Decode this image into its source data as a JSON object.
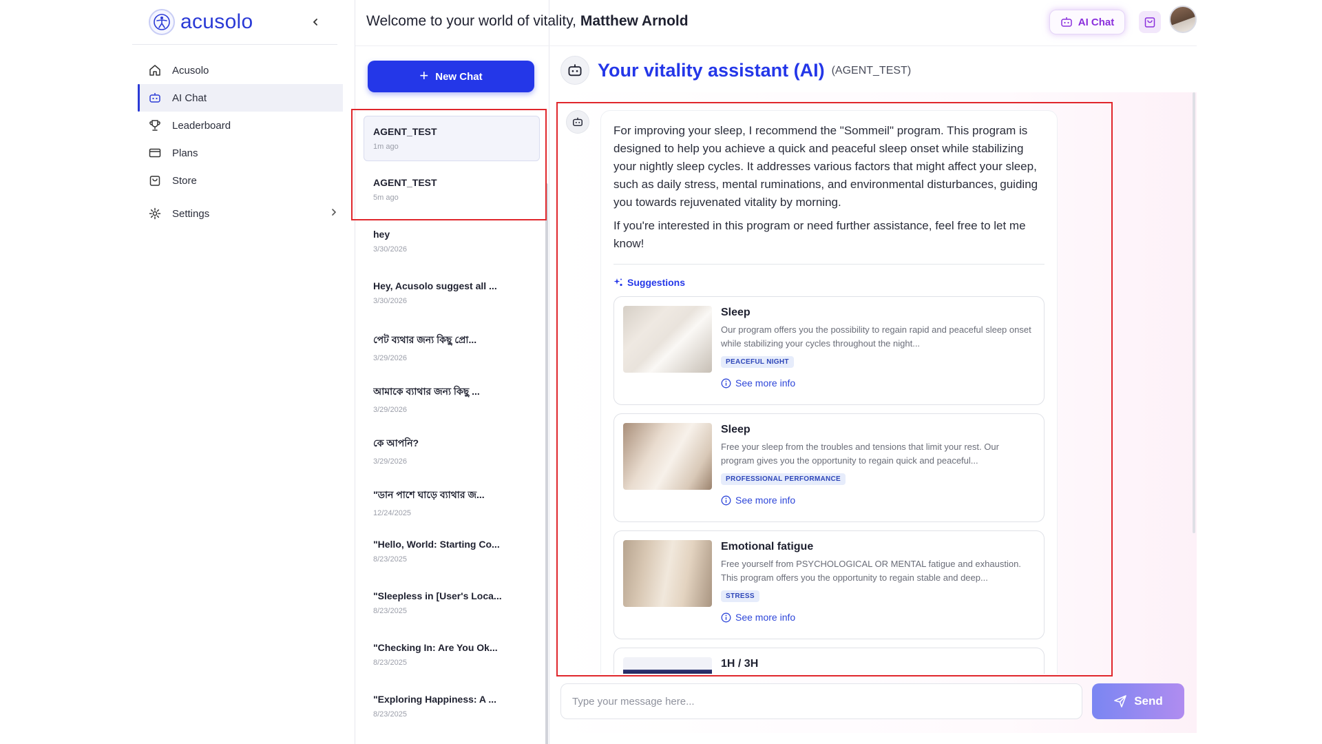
{
  "brand": {
    "name": "acusolo"
  },
  "sidebar": {
    "items": [
      {
        "label": "Acusolo",
        "icon": "home-icon"
      },
      {
        "label": "AI Chat",
        "icon": "robot-icon",
        "active": true
      },
      {
        "label": "Leaderboard",
        "icon": "trophy-icon"
      },
      {
        "label": "Plans",
        "icon": "card-icon"
      },
      {
        "label": "Store",
        "icon": "bag-icon"
      },
      {
        "label": "Settings",
        "icon": "gear-icon"
      }
    ]
  },
  "header": {
    "welcome_prefix": "Welcome to your world of vitality,",
    "user_name": "Matthew Arnold",
    "ai_chat_label": "AI Chat"
  },
  "history": {
    "new_chat_label": "New Chat",
    "items": [
      {
        "title": "AGENT_TEST",
        "time": "1m ago",
        "active": true
      },
      {
        "title": "AGENT_TEST",
        "time": "5m ago"
      },
      {
        "title": "hey",
        "time": "3/30/2026"
      },
      {
        "title": "Hey, Acusolo suggest all ...",
        "time": "3/30/2026"
      },
      {
        "title": "পেট ব্যথার জন্য কিছু প্রো...",
        "time": "3/29/2026"
      },
      {
        "title": "আমাকে ব্যাথার জন্য কিছু ...",
        "time": "3/29/2026"
      },
      {
        "title": "কে আপনি?",
        "time": "3/29/2026"
      },
      {
        "title": "\"ডান পাশে ঘাড়ে ব্যাথার জ...",
        "time": "12/24/2025"
      },
      {
        "title": "\"Hello, World: Starting Co...",
        "time": "8/23/2025"
      },
      {
        "title": "\"Sleepless in [User's Loca...",
        "time": "8/23/2025"
      },
      {
        "title": "\"Checking In: Are You Ok...",
        "time": "8/23/2025"
      },
      {
        "title": "\"Exploring Happiness: A ...",
        "time": "8/23/2025"
      }
    ]
  },
  "assistant": {
    "title": "Your vitality assistant (AI)",
    "tag": "(AGENT_TEST)"
  },
  "message": {
    "paragraphs": [
      "For improving your sleep, I recommend the \"Sommeil\" program. This program is designed to help you achieve a quick and peaceful sleep onset while stabilizing your nightly sleep cycles. It addresses various factors that might affect your sleep, such as daily stress, mental ruminations, and environmental disturbances, guiding you towards rejuvenated vitality by morning.",
      "If you're interested in this program or need further assistance, feel free to let me know!"
    ],
    "suggestions_label": "Suggestions",
    "suggestions": [
      {
        "title": "Sleep",
        "description": "Our program offers you the possibility to regain rapid and peaceful sleep onset while stabilizing your cycles throughout the night...",
        "badge": "PEACEFUL NIGHT",
        "more_label": "See more info"
      },
      {
        "title": "Sleep",
        "description": "Free your sleep from the troubles and tensions that limit your rest. Our program gives you the opportunity to regain quick and peaceful...",
        "badge": "PROFESSIONAL PERFORMANCE",
        "more_label": "See more info"
      },
      {
        "title": "Emotional fatigue",
        "description": "Free yourself from PSYCHOLOGICAL OR MENTAL fatigue and exhaustion. This program offers you the opportunity to regain stable and deep...",
        "badge": "STRESS",
        "more_label": "See more info"
      },
      {
        "title": "1H / 3H"
      }
    ]
  },
  "composer": {
    "placeholder": "Type your message here...",
    "send_label": "Send"
  },
  "colors": {
    "brand_blue": "#2437e8",
    "ai_chat_purple": "#8a2fdc",
    "highlight_red": "#e0262b"
  }
}
